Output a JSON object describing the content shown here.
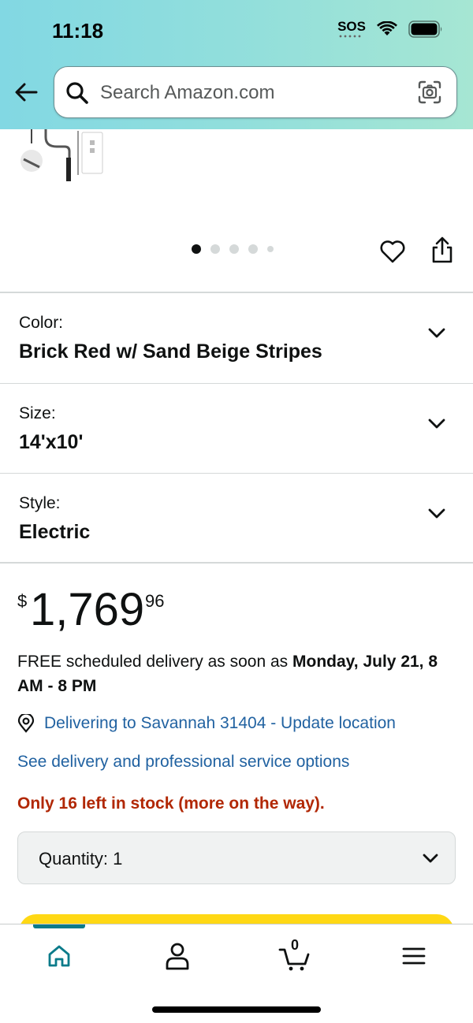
{
  "status_bar": {
    "time": "11:18",
    "sos": "SOS"
  },
  "search": {
    "placeholder": "Search Amazon.com"
  },
  "carousel": {
    "pages": 5,
    "active_page": 1
  },
  "variations": {
    "color": {
      "label": "Color:",
      "value": "Brick Red w/ Sand Beige Stripes"
    },
    "size": {
      "label": "Size:",
      "value": "14'x10'"
    },
    "style": {
      "label": "Style:",
      "value": "Electric"
    }
  },
  "price": {
    "currency": "$",
    "whole": "1,769",
    "fraction": "96"
  },
  "delivery": {
    "prefix": "FREE scheduled delivery as soon as ",
    "date": "Monday, July 21, 8 AM - 8 PM"
  },
  "location": {
    "text": "Delivering to Savannah 31404 - Update location"
  },
  "service_link": "See delivery and professional service options",
  "stock": "Only 16 left in stock (more on the way).",
  "quantity": {
    "label": "Quantity:",
    "value": "1"
  },
  "bottom_nav": {
    "cart_count": "0"
  },
  "colors": {
    "header_start": "#82d8e3",
    "header_end": "#a6e6d3",
    "link": "#2162a1",
    "stock_warning": "#b12704",
    "button_yellow": "#ffd814",
    "nav_active": "#0b7b8a"
  },
  "icons": [
    "back-arrow-icon",
    "search-icon",
    "camera-icon",
    "heart-icon",
    "share-icon",
    "chevron-down-icon",
    "location-pin-icon",
    "home-icon",
    "account-icon",
    "cart-icon",
    "menu-icon",
    "wifi-icon",
    "battery-icon"
  ]
}
